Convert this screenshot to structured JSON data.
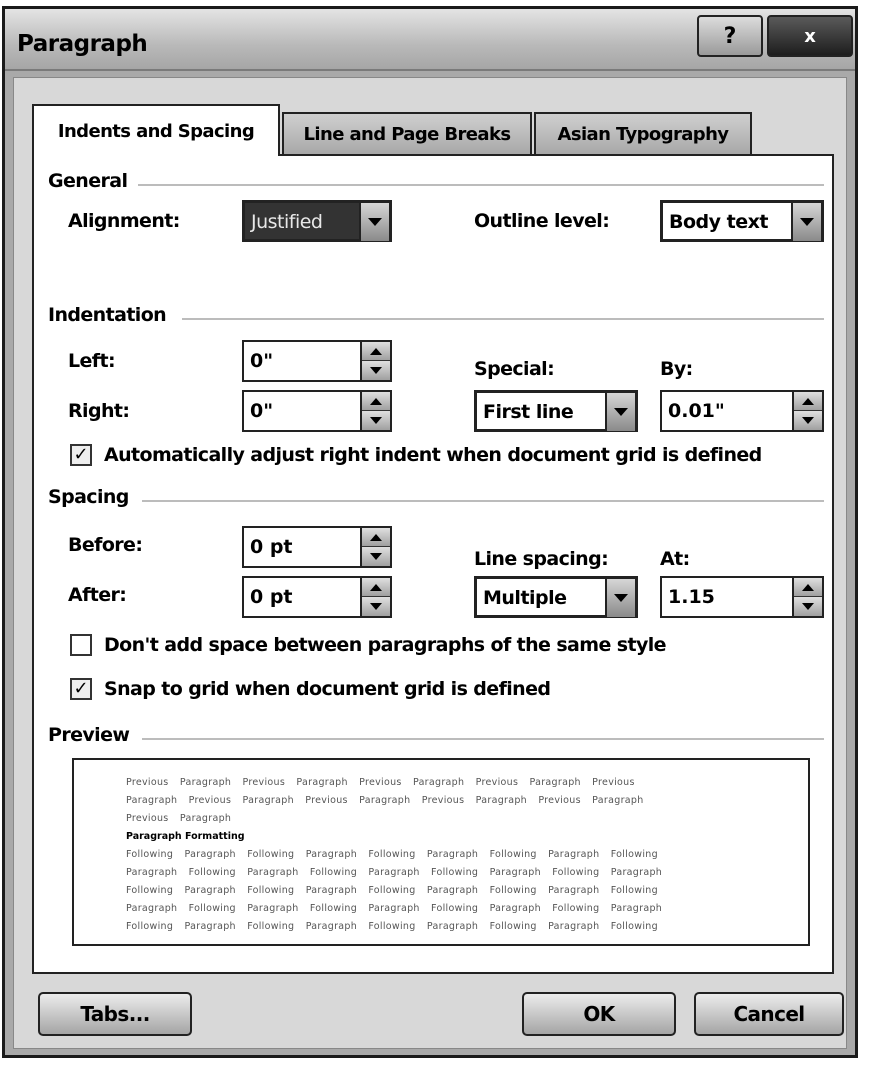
{
  "window": {
    "title": "Paragraph",
    "help_label": "?",
    "close_label": "x"
  },
  "tabs": [
    {
      "label": "Indents and Spacing",
      "active": true
    },
    {
      "label": "Line and Page Breaks",
      "active": false
    },
    {
      "label": "Asian Typography",
      "active": false
    }
  ],
  "general": {
    "heading": "General",
    "alignment_label": "Alignment:",
    "alignment_value": "Justified",
    "outline_label": "Outline level:",
    "outline_value": "Body text"
  },
  "indentation": {
    "heading": "Indentation",
    "left_label": "Left:",
    "left_value": "0\"",
    "right_label": "Right:",
    "right_value": "0\"",
    "special_label": "Special:",
    "special_value": "First line",
    "by_label": "By:",
    "by_value": "0.01\"",
    "auto_adjust_label": "Automatically adjust right indent when document grid is defined",
    "auto_adjust_checked": true
  },
  "spacing": {
    "heading": "Spacing",
    "before_label": "Before:",
    "before_value": "0 pt",
    "after_label": "After:",
    "after_value": "0 pt",
    "line_spacing_label": "Line spacing:",
    "line_spacing_value": "Multiple",
    "at_label": "At:",
    "at_value": "1.15",
    "dont_add_label": "Don't add space between paragraphs of the same style",
    "dont_add_checked": false,
    "snap_label": "Snap to grid when document grid is defined",
    "snap_checked": true
  },
  "preview": {
    "heading": "Preview",
    "lines": [
      "Previous Paragraph Previous Paragraph Previous Paragraph Previous Paragraph Previous",
      "Paragraph Previous Paragraph Previous Paragraph Previous Paragraph Previous Paragraph",
      "Previous Paragraph"
    ],
    "bold_line": "Paragraph Formatting",
    "following_lines": [
      "Following Paragraph Following Paragraph Following Paragraph Following Paragraph Following",
      "Paragraph Following Paragraph Following Paragraph Following Paragraph Following Paragraph",
      "Following Paragraph Following Paragraph Following Paragraph Following Paragraph Following",
      "Paragraph Following Paragraph Following Paragraph Following Paragraph Following Paragraph",
      "Following Paragraph Following Paragraph Following Paragraph Following Paragraph Following"
    ]
  },
  "buttons": {
    "tabs_label": "Tabs...",
    "ok_label": "OK",
    "cancel_label": "Cancel"
  },
  "check_mark": "✓"
}
